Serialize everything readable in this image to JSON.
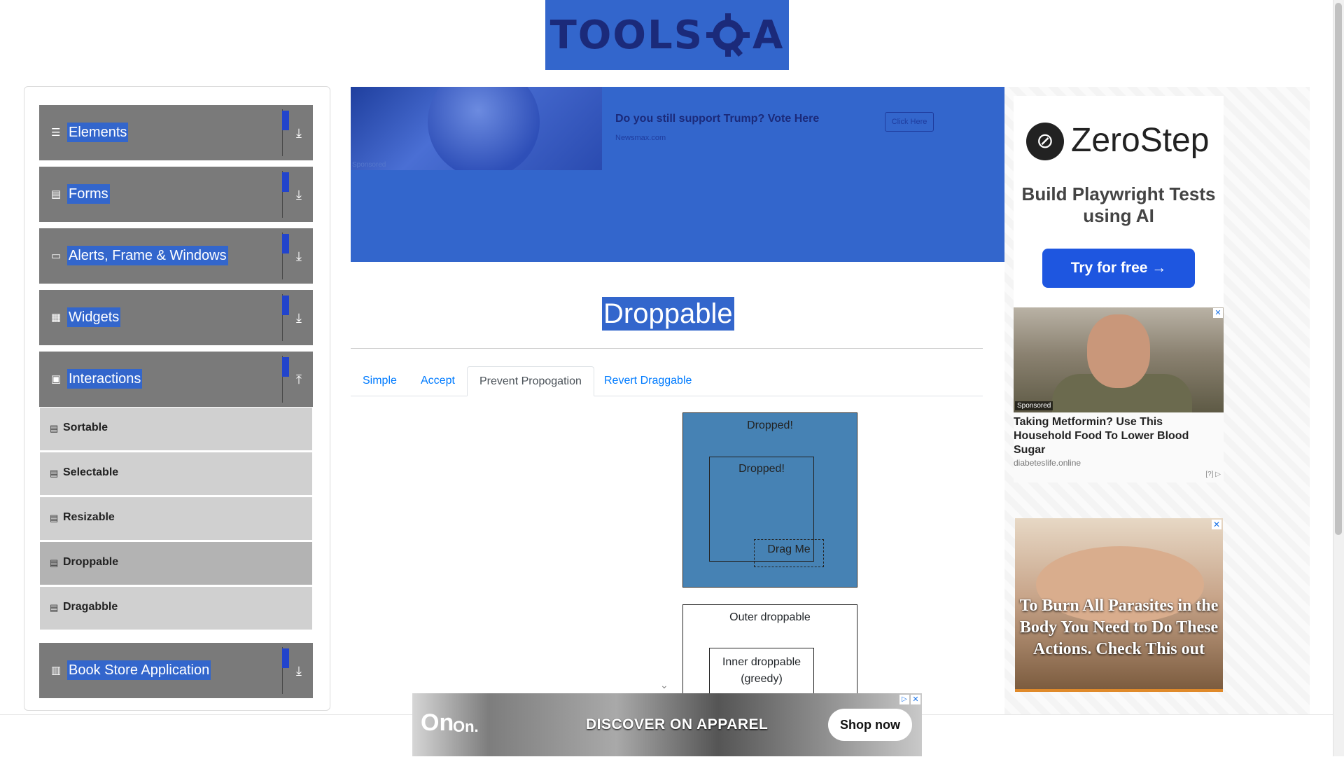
{
  "header": {
    "logo_text": "TOOLS",
    "logo_text_end": "A"
  },
  "sidebar": {
    "groups": [
      {
        "label": "Elements",
        "icon": "hamburger-icon"
      },
      {
        "label": "Forms",
        "icon": "document-icon"
      },
      {
        "label": "Alerts, Frame & Windows",
        "icon": "window-icon"
      },
      {
        "label": "Widgets",
        "icon": "grid-icon"
      },
      {
        "label": "Interactions",
        "icon": "interaction-icon"
      },
      {
        "label": "Book Store Application",
        "icon": "books-icon"
      }
    ],
    "interaction_items": [
      {
        "label": "Sortable"
      },
      {
        "label": "Selectable"
      },
      {
        "label": "Resizable"
      },
      {
        "label": "Droppable",
        "active": true
      },
      {
        "label": "Dragabble"
      }
    ]
  },
  "top_ad": {
    "headline": "Do you still support Trump? Vote Here",
    "source": "Newsmax.com",
    "button": "Click Here",
    "sponsored": "Sponsored"
  },
  "main": {
    "title": "Droppable",
    "tabs": [
      {
        "label": "Simple"
      },
      {
        "label": "Accept"
      },
      {
        "label": "Prevent Propogation",
        "active": true
      },
      {
        "label": "Revert Draggable"
      }
    ],
    "not_greedy_outer_label": "Dropped!",
    "not_greedy_inner_label": "Dropped!",
    "drag_label": "Drag Me",
    "greedy_outer_label": "Outer droppable",
    "greedy_inner_label": "Inner droppable (greedy)"
  },
  "right_ads": {
    "zerostep": {
      "brand": "ZeroStep",
      "line": "Build Playwright Tests using AI",
      "cta": "Try for free →"
    },
    "metformin": {
      "sponsored": "Sponsored",
      "headline": "Taking Metformin? Use This Household Food To Lower Blood Sugar",
      "source": "diabeteslife.online",
      "adchoice": "[?]"
    },
    "parasites": {
      "headline": "To Burn All Parasites in the Body You Need to Do These Actions. Check This out"
    }
  },
  "bottom_ad": {
    "logo": "On",
    "brand": "On.",
    "headline": "DISCOVER ON APPAREL",
    "cta": "Shop now"
  },
  "colors": {
    "accent": "#3366cc",
    "group_bg": "#7a7a7a",
    "droppable_active": "#4682b4",
    "link": "#007bff"
  }
}
